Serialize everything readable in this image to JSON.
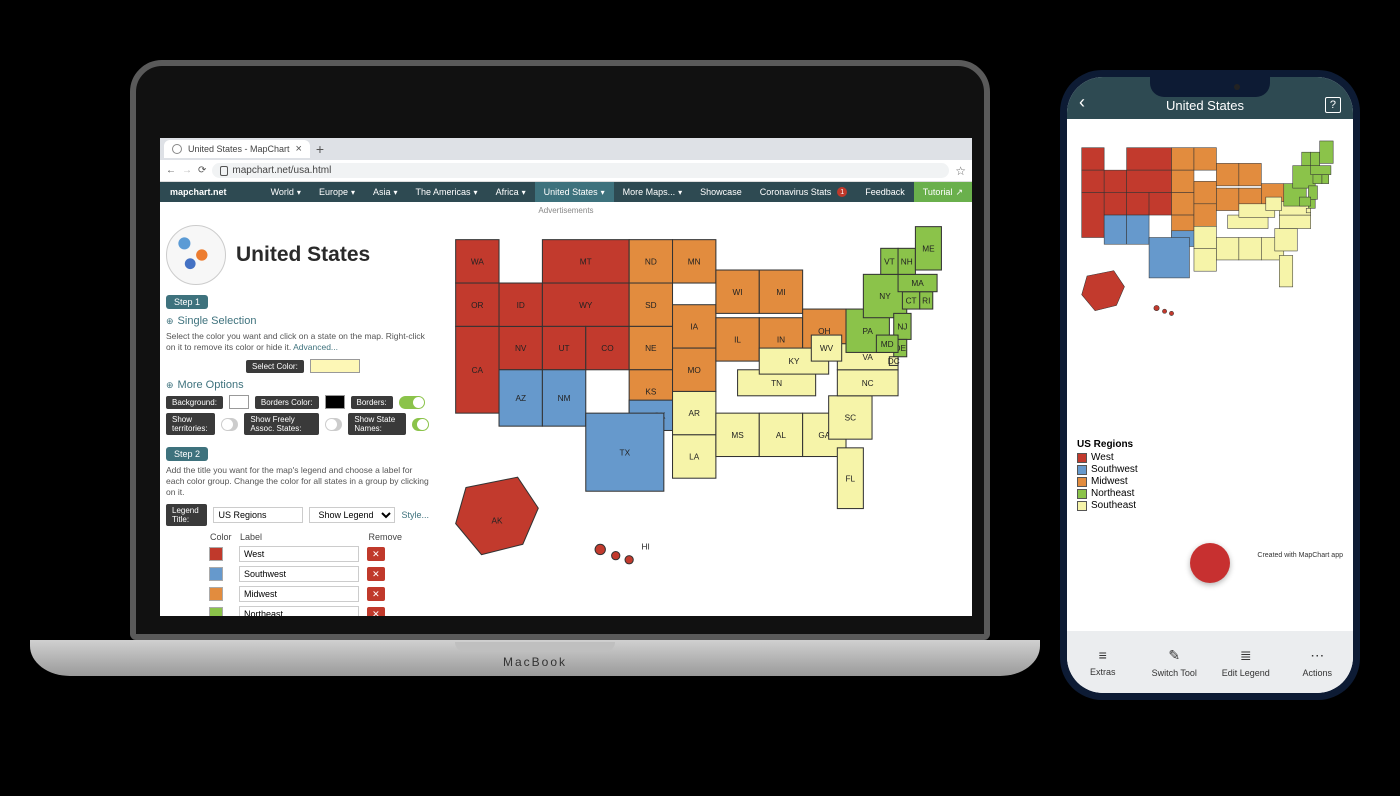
{
  "browser": {
    "tab_title": "United States - MapChart",
    "url": "mapchart.net/usa.html"
  },
  "nav": {
    "brand": "mapchart.net",
    "items": [
      "World",
      "Europe",
      "Asia",
      "The Americas",
      "Africa",
      "United States",
      "More Maps...",
      "Showcase",
      "Coronavirus Stats",
      "Feedback"
    ],
    "tutorial": "Tutorial"
  },
  "ads_label": "Advertisements",
  "page": {
    "title": "United States",
    "step1": "Step 1",
    "single_sel": "Single Selection",
    "hint1": "Select the color you want and click on a state on the map. Right-click on it to remove its color or hide it.",
    "advanced": "Advanced...",
    "select_color": "Select Color:",
    "more_options": "More Options",
    "opts": {
      "background": "Background:",
      "borders_color": "Borders Color:",
      "borders": "Borders:",
      "show_territories": "Show territories:",
      "show_freely": "Show Freely Assoc. States:",
      "show_names": "Show State Names:"
    },
    "step2": "Step 2",
    "hint2": "Add the title you want for the map's legend and choose a label for each color group. Change the color for all states in a group by clicking on it.",
    "legend_title_lbl": "Legend Title:",
    "legend_title_val": "US Regions",
    "show_legend": "Show Legend",
    "style": "Style...",
    "th": {
      "color": "Color",
      "label": "Label",
      "remove": "Remove"
    },
    "rows": [
      {
        "color": "#c0392b",
        "label": "West"
      },
      {
        "color": "#6699cc",
        "label": "Southwest"
      },
      {
        "color": "#e28c3e",
        "label": "Midwest"
      },
      {
        "color": "#8bc34a",
        "label": "Northeast"
      }
    ]
  },
  "regions": {
    "west": {
      "fill": "#c23a2d",
      "states": [
        "WA",
        "OR",
        "CA",
        "NV",
        "ID",
        "UT",
        "MT",
        "WY",
        "CO",
        "AK",
        "HI"
      ]
    },
    "southwest": {
      "fill": "#6699cc",
      "states": [
        "AZ",
        "NM",
        "TX",
        "OK"
      ]
    },
    "midwest": {
      "fill": "#e28c3e",
      "states": [
        "ND",
        "SD",
        "NE",
        "KS",
        "MN",
        "IA",
        "MO",
        "WI",
        "IL",
        "IN",
        "MI",
        "OH"
      ]
    },
    "northeast": {
      "fill": "#8bc34a",
      "states": [
        "PA",
        "NY",
        "NJ",
        "CT",
        "RI",
        "MA",
        "VT",
        "NH",
        "ME",
        "DE",
        "MD"
      ]
    },
    "southeast": {
      "fill": "#f6f4a9",
      "states": [
        "WV",
        "VA",
        "KY",
        "TN",
        "NC",
        "SC",
        "GA",
        "FL",
        "AL",
        "MS",
        "LA",
        "AR",
        "DC"
      ]
    }
  },
  "phone": {
    "title": "United States",
    "legend_title": "US Regions",
    "legend": [
      {
        "color": "#c23a2d",
        "label": "West"
      },
      {
        "color": "#6699cc",
        "label": "Southwest"
      },
      {
        "color": "#e28c3e",
        "label": "Midwest"
      },
      {
        "color": "#8bc34a",
        "label": "Northeast"
      },
      {
        "color": "#f6f4a9",
        "label": "Southeast"
      }
    ],
    "credit": "Created with MapChart app",
    "bottom": [
      "Extras",
      "Switch Tool",
      "Edit Legend",
      "Actions"
    ]
  }
}
